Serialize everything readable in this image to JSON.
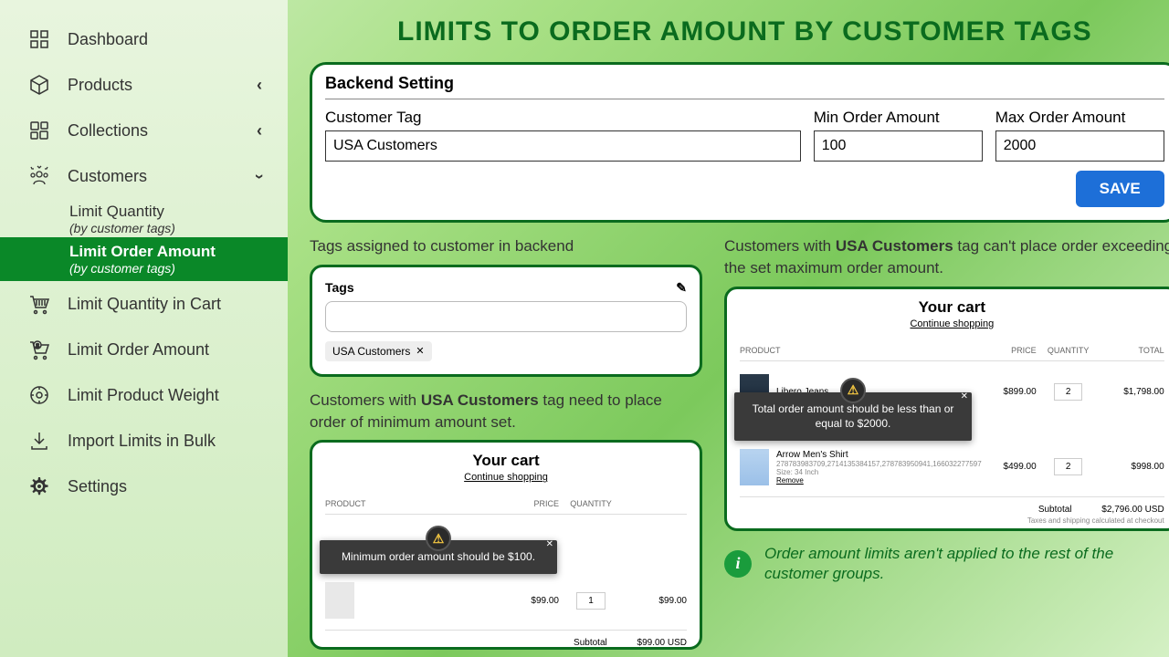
{
  "sidebar": {
    "dashboard": "Dashboard",
    "products": "Products",
    "collections": "Collections",
    "customers": "Customers",
    "subs": [
      {
        "label": "Limit Quantity",
        "detail": "(by customer tags)"
      },
      {
        "label": "Limit Order Amount",
        "detail": "(by customer tags)"
      }
    ],
    "limit_qty_cart": "Limit Quantity in Cart",
    "limit_order_amount": "Limit Order Amount",
    "limit_weight": "Limit Product Weight",
    "import_bulk": "Import Limits in Bulk",
    "settings": "Settings"
  },
  "page_title": "LIMITS TO ORDER AMOUNT BY CUSTOMER TAGS",
  "backend": {
    "title": "Backend Setting",
    "tag_label": "Customer Tag",
    "tag_value": "USA Customers",
    "min_label": "Min Order Amount",
    "min_value": "100",
    "max_label": "Max Order Amount",
    "max_value": "2000",
    "save": "SAVE"
  },
  "tags_section": {
    "label": "Tags assigned to customer in backend",
    "header": "Tags",
    "chip": "USA Customers"
  },
  "min_section": {
    "label_a": "Customers with ",
    "label_b": "USA Customers",
    "label_c": " tag need to place order of minimum amount set.",
    "cart_title": "Your cart",
    "continue": "Continue shopping",
    "headers": {
      "product": "PRODUCT",
      "price": "PRICE",
      "quantity": "QUANTITY"
    },
    "row": {
      "price": "$99.00",
      "qty": "1",
      "total": "$99.00"
    },
    "subtotal_label": "Subtotal",
    "subtotal_value": "$99.00 USD",
    "tooltip": "Minimum order amount should be $100."
  },
  "max_section": {
    "label_a": "Customers with ",
    "label_b": "USA Customers",
    "label_c": " tag can't place order exceeding the set maximum order amount.",
    "cart_title": "Your cart",
    "continue": "Continue shopping",
    "headers": {
      "product": "PRODUCT",
      "price": "PRICE",
      "quantity": "QUANTITY",
      "total": "TOTAL"
    },
    "rows": [
      {
        "name": "Libero Jeans",
        "sku": "",
        "price": "$899.00",
        "qty": "2",
        "total": "$1,798.00"
      },
      {
        "name": "Arrow Men's Shirt",
        "sku": "278783983709,2714135384157,278783950941,166032277597",
        "size": "Size: 34 Inch",
        "remove": "Remove",
        "price": "$499.00",
        "qty": "2",
        "total": "$998.00"
      }
    ],
    "subtotal_label": "Subtotal",
    "subtotal_value": "$2,796.00 USD",
    "tax_note": "Taxes and shipping calculated at checkout",
    "tooltip": "Total order amount should be less than or equal to $2000."
  },
  "info_note": "Order amount limits aren't applied to the rest of the customer groups."
}
